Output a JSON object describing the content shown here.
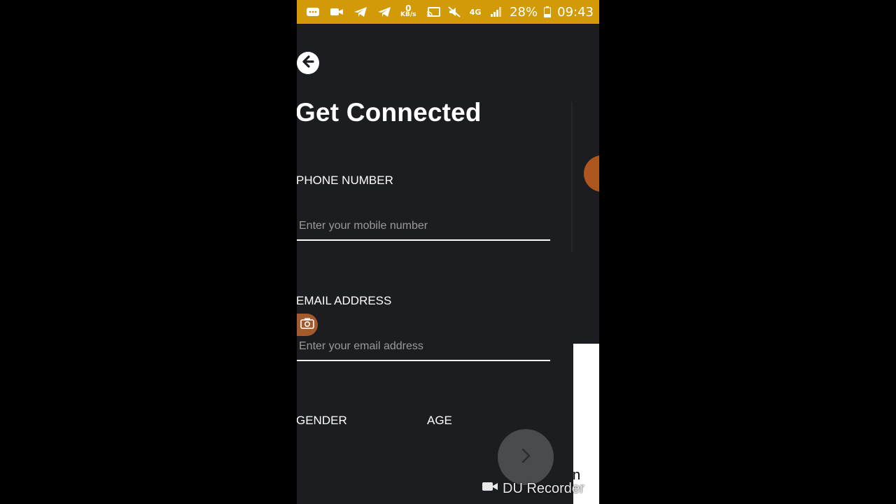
{
  "status_bar": {
    "netspeed_value": "0",
    "netspeed_unit": "KB/s",
    "network": "4G",
    "battery": "28%",
    "time": "09:43",
    "icons": [
      "message-icon",
      "video-icon",
      "telegram-icon",
      "telegram-icon",
      "netspeed",
      "cast-icon",
      "mute-icon",
      "4g-icon",
      "signal-icon",
      "battery-icon"
    ]
  },
  "header": {
    "back_icon": "arrow-left-icon",
    "title": "Get Connected"
  },
  "form": {
    "phone_label": "PHONE NUMBER",
    "phone_placeholder": "Enter your mobile number",
    "email_label": "EMAIL ADDRESS",
    "email_placeholder": "Enter your email address",
    "gender_label": "GENDER",
    "age_label": "AGE"
  },
  "next_button": {
    "icon": "chevron-right-icon"
  },
  "overlay": {
    "recorder_watermark": "DU Recorder",
    "stray_text": "n"
  },
  "colors": {
    "status_bar": "#d19a06",
    "background": "#1c1d21",
    "text": "#ffffff",
    "placeholder": "#9a9a9a"
  }
}
